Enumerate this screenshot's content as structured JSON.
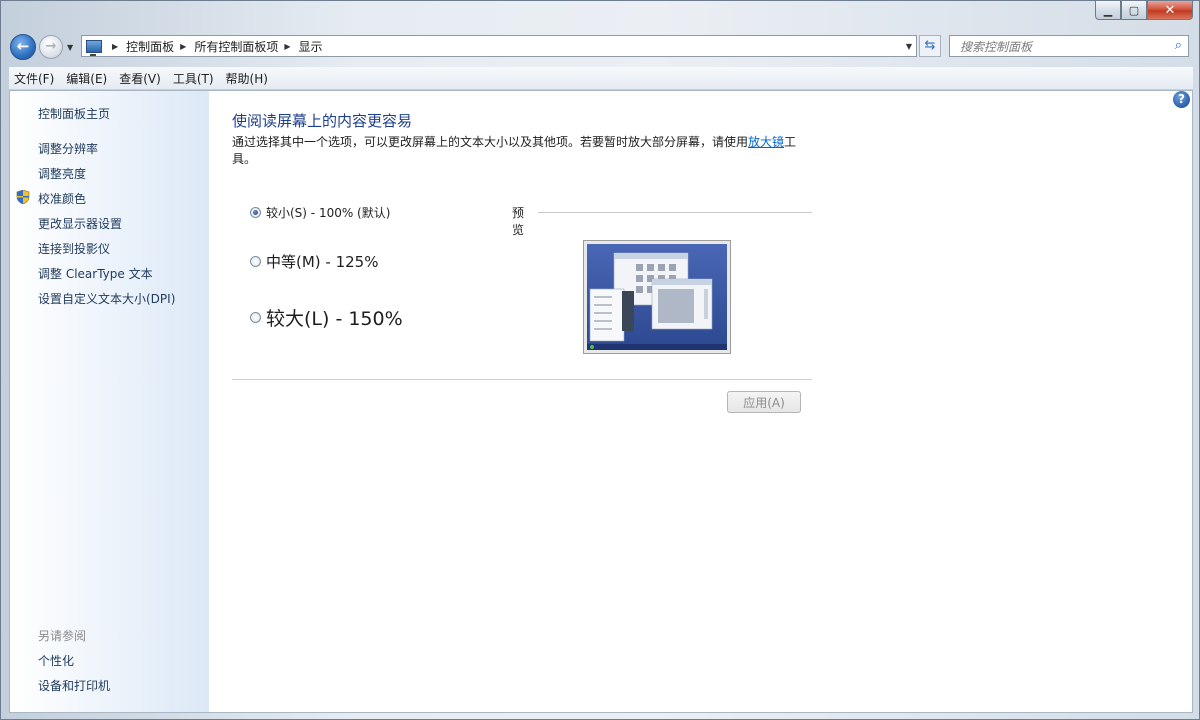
{
  "window": {
    "caption_buttons": [
      "minimize-icon",
      "maximize-icon",
      "close-icon"
    ]
  },
  "nav": {
    "back_icon": "back-arrow-icon",
    "forward_icon": "forward-arrow-icon",
    "breadcrumbs": [
      "控制面板",
      "所有控制面板项",
      "显示"
    ],
    "search_placeholder": "搜索控制面板"
  },
  "menu": {
    "items": [
      "文件(F)",
      "编辑(E)",
      "查看(V)",
      "工具(T)",
      "帮助(H)"
    ]
  },
  "sidebar": {
    "home": "控制面板主页",
    "links": [
      "调整分辨率",
      "调整亮度",
      "校准颜色",
      "更改显示器设置",
      "连接到投影仪",
      "调整 ClearType 文本",
      "设置自定义文本大小(DPI)"
    ],
    "see_also_title": "另请参阅",
    "see_also": [
      "个性化",
      "设备和打印机"
    ]
  },
  "main": {
    "title": "使阅读屏幕上的内容更容易",
    "description_before": "通过选择其中一个选项，可以更改屏幕上的文本大小以及其他项。若要暂时放大部分屏幕，请使用",
    "magnifier_link": "放大镜",
    "description_after": "工具。",
    "options": [
      {
        "label": "较小(S) - 100% (默认)",
        "checked": true
      },
      {
        "label": "中等(M) - 125%",
        "checked": false
      },
      {
        "label": "较大(L) - 150%",
        "checked": false
      }
    ],
    "preview_label": "预览",
    "apply_label": "应用(A)"
  }
}
